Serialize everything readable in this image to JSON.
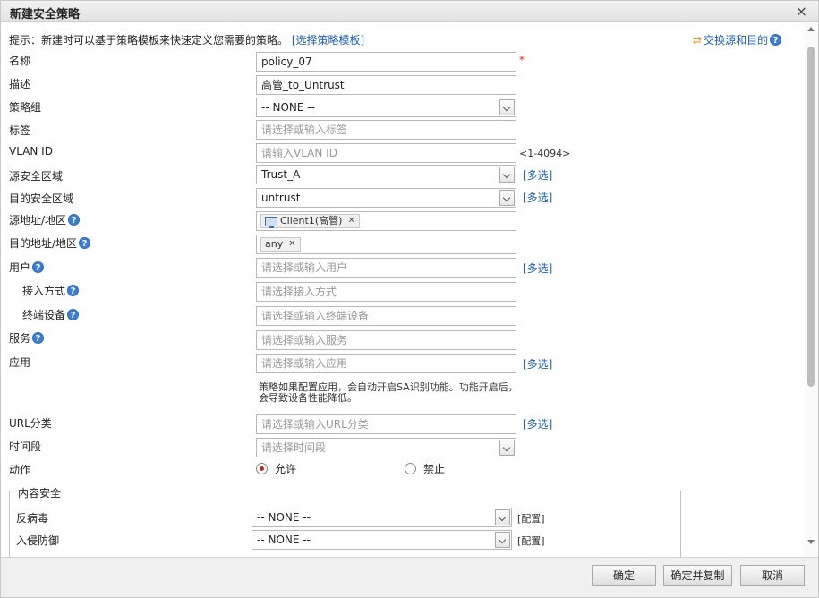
{
  "dialog": {
    "title": "新建安全策略",
    "close": "×"
  },
  "hint": {
    "text": "提示：新建时可以基于策略模板来快速定义您需要的策略。",
    "link": "[选择策略模板]"
  },
  "swap": {
    "label": "交换源和目的"
  },
  "help_glyph": "?",
  "form": {
    "name": {
      "label": "名称",
      "value": "policy_07",
      "required": "*"
    },
    "desc": {
      "label": "描述",
      "value": "高管_to_Untrust"
    },
    "group": {
      "label": "策略组",
      "value": "-- NONE --"
    },
    "tag": {
      "label": "标签",
      "placeholder": "请选择或输入标签"
    },
    "vlan": {
      "label": "VLAN ID",
      "placeholder": "请输入VLAN ID",
      "range": "<1-4094>"
    },
    "src_zone": {
      "label": "源安全区域",
      "value": "Trust_A",
      "multi": "[多选]"
    },
    "dst_zone": {
      "label": "目的安全区域",
      "value": "untrust",
      "multi": "[多选]"
    },
    "src_addr": {
      "label": "源地址/地区",
      "tag": "Client1(高管)"
    },
    "dst_addr": {
      "label": "目的地址/地区",
      "tag": "any"
    },
    "user": {
      "label": "用户",
      "placeholder": "请选择或输入用户",
      "multi": "[多选]"
    },
    "access": {
      "label": "接入方式",
      "placeholder": "请选择接入方式"
    },
    "device": {
      "label": "终端设备",
      "placeholder": "请选择或输入终端设备"
    },
    "service": {
      "label": "服务",
      "placeholder": "请选择或输入服务"
    },
    "app": {
      "label": "应用",
      "placeholder": "请选择或输入应用",
      "multi": "[多选]",
      "note": "策略如果配置应用，会自动开启SA识别功能。功能开启后，会导致设备性能降低。"
    },
    "url": {
      "label": "URL分类",
      "placeholder": "请选择或输入URL分类",
      "multi": "[多选]"
    },
    "time": {
      "label": "时间段",
      "placeholder": "请选择时间段"
    },
    "action": {
      "label": "动作",
      "permit": "允许",
      "deny": "禁止",
      "selected": "permit"
    }
  },
  "content_security": {
    "legend": "内容安全",
    "antivirus": {
      "label": "反病毒",
      "value": "-- NONE --",
      "config": "[配置]"
    },
    "ips": {
      "label": "入侵防御",
      "value": "-- NONE --",
      "config": "[配置]"
    }
  },
  "buttons": {
    "ok": "确定",
    "ok_copy": "确定并复制",
    "cancel": "取消"
  }
}
